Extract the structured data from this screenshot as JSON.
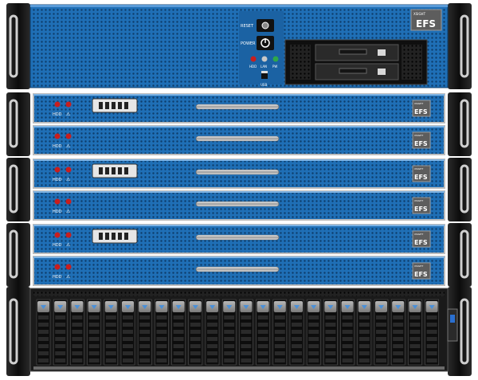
{
  "image_kind": "server-rack-illustration",
  "colors": {
    "panel_blue": "#1f6fb6",
    "panel_blue_dark": "#124c84",
    "rail_black": "#141414",
    "bay_dark": "#1a1a1a",
    "handle_silver": "#d9d9d9",
    "led_red": "#c81e1e",
    "led_green": "#2ea84a"
  },
  "head_unit": {
    "reset_label": "RESET",
    "power_label": "POWER",
    "led_labels": [
      "HDD",
      "LAN",
      "PW"
    ],
    "usb_label": "USB",
    "logo_top": "XSIGHT",
    "logo_main": "EFS"
  },
  "node_units": {
    "count": 6,
    "hdd_label": "HDD",
    "warn_label": "⚠",
    "logo_top": "XSIGHT",
    "logo_main": "EFS"
  },
  "storage_unit": {
    "drive_bays": 24
  }
}
